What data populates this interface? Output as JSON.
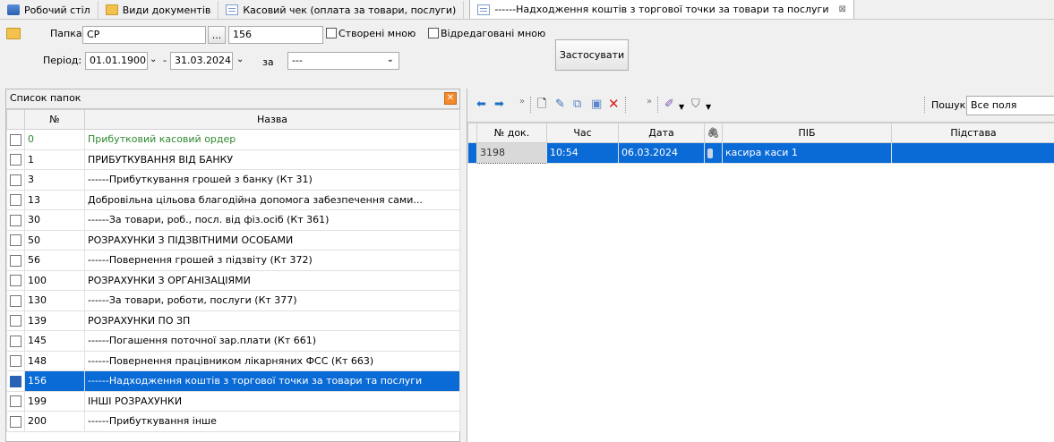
{
  "tabs": [
    {
      "label": "Робочий стіл",
      "icon": "desktop-icon"
    },
    {
      "label": "Види документів",
      "icon": "folder-icon"
    },
    {
      "label": "Касовий чек (оплата за товари, послуги)",
      "icon": "document-icon"
    },
    {
      "label": "------Надходження коштів з торгової точки за товари та послуги",
      "icon": "document-icon",
      "close": "⊠"
    }
  ],
  "filter": {
    "folder_label": "Папка",
    "folder_value": "СР",
    "browse_label": "...",
    "folder_num": "156",
    "created_by_me": "Створені мною",
    "edited_by_me": "Відредаговані мною",
    "period_label": "Період:",
    "date_from": "01.01.1900",
    "dash": "-",
    "date_to": "31.03.2024",
    "by_label": "за",
    "by_value": "---",
    "apply_button": "Застосувати"
  },
  "folders": {
    "title": "Список папок",
    "col_no": "№",
    "col_name": "Назва",
    "rows": [
      {
        "no": "0",
        "name": "Прибутковий касовий ордер",
        "style": "green"
      },
      {
        "no": "1",
        "name": "ПРИБУТКУВАННЯ ВІД БАНКУ"
      },
      {
        "no": "3",
        "name": "------Прибуткування грошей з банку (Кт 31)"
      },
      {
        "no": "13",
        "name": "Добровільна цільова благодійна допомога забезпечення сами..."
      },
      {
        "no": "30",
        "name": "------За товари, роб., посл. від фіз.осіб (Кт 361)"
      },
      {
        "no": "50",
        "name": "РОЗРАХУНКИ З ПІДЗВІТНИМИ ОСОБАМИ"
      },
      {
        "no": "56",
        "name": "------Повернення грошей з підзвіту (Кт 372)"
      },
      {
        "no": "100",
        "name": "РОЗРАХУНКИ З ОРГАНІЗАЦІЯМИ"
      },
      {
        "no": "130",
        "name": "------За товари, роботи, послуги (Кт 377)"
      },
      {
        "no": "139",
        "name": "РОЗРАХУНКИ ПО ЗП"
      },
      {
        "no": "145",
        "name": "------Погашення поточної зар.плати (Кт 661)"
      },
      {
        "no": "148",
        "name": "------Повернення працівником лікарняних ФСС (Кт 663)"
      },
      {
        "no": "156",
        "name": "------Надходження коштів з торгової точки за товари та послуги",
        "selected": true
      },
      {
        "no": "199",
        "name": "ІНШІ РОЗРАХУНКИ"
      },
      {
        "no": "200",
        "name": "------Прибуткування інше"
      }
    ]
  },
  "docs": {
    "search_label": "Пошук:",
    "search_value": "Все поля",
    "columns": {
      "no": "№ док.",
      "time": "Час",
      "date": "Дата",
      "pib": "ПІБ",
      "reason": "Підстава"
    },
    "rows": [
      {
        "no": "3198",
        "time": "10:54",
        "date": "06.03.2024",
        "pib": "касира каси 1",
        "reason": ""
      }
    ]
  },
  "colors": {
    "selection": "#0a6bd6",
    "accent_green": "#2f8a2f",
    "close_orange": "#f38a2b"
  }
}
